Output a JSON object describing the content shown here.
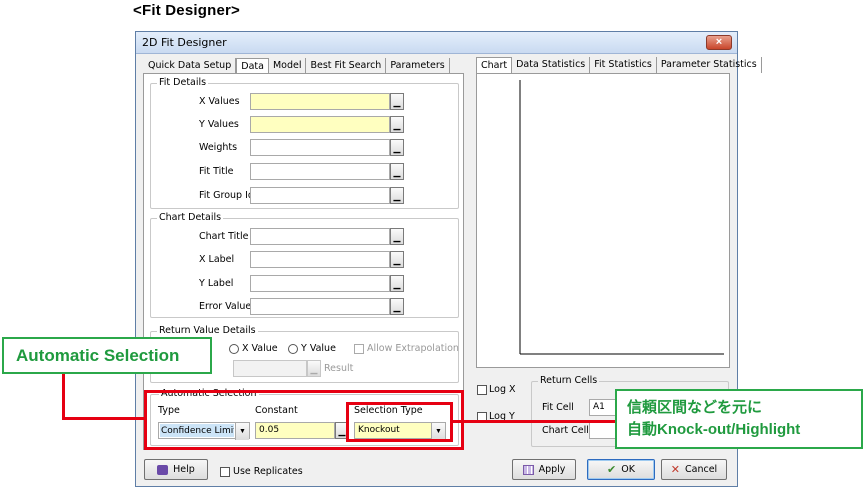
{
  "heading": "<Fit Designer>",
  "window": {
    "title": "2D Fit Designer",
    "close_icon": "×"
  },
  "left_tabs": [
    "Quick Data Setup",
    "Data",
    "Model",
    "Best Fit Search",
    "Parameters"
  ],
  "left_tabs_active": "Data",
  "fit_details": {
    "legend": "Fit Details",
    "rows": [
      {
        "label": "X Values",
        "value": "",
        "highlight": "#ffffc0"
      },
      {
        "label": "Y Values",
        "value": "",
        "highlight": "#ffffc0"
      },
      {
        "label": "Weights",
        "value": ""
      },
      {
        "label": "Fit Title",
        "value": ""
      },
      {
        "label": "Fit Group Id",
        "value": ""
      }
    ]
  },
  "chart_details": {
    "legend": "Chart Details",
    "rows": [
      {
        "label": "Chart Title",
        "value": ""
      },
      {
        "label": "X Label",
        "value": ""
      },
      {
        "label": "Y Label",
        "value": ""
      },
      {
        "label": "Error Values",
        "value": ""
      }
    ]
  },
  "return_value_details": {
    "legend": "Return Value Details",
    "x_value": "X Value",
    "y_value": "Y Value",
    "allow_extrapolation": "Allow Extrapolation",
    "result_label": "Result"
  },
  "automatic_selection": {
    "legend": "Automatic Selection",
    "type_label": "Type",
    "type_value": "Confidence Limits",
    "constant_label": "Constant",
    "constant_value": "0.05",
    "selection_type_label": "Selection Type",
    "selection_type_value": "Knockout"
  },
  "right_tabs": [
    "Chart",
    "Data Statistics",
    "Fit Statistics",
    "Parameter Statistics"
  ],
  "right_tabs_active": "Chart",
  "log_x": "Log X",
  "log_y": "Log Y",
  "return_cells": {
    "legend": "Return Cells",
    "fit_cell_label": "Fit Cell",
    "fit_cell_value": "A1",
    "chart_cell_label": "Chart Cell",
    "chart_cell_value": ""
  },
  "bottom": {
    "help": "Help",
    "use_replicates": "Use Replicates",
    "apply": "Apply",
    "ok": "OK",
    "cancel": "Cancel"
  },
  "callouts": {
    "left": "Automatic Selection",
    "right_line1": "信頼区間などを元に",
    "right_line2": "自動Knock-out/Highlight"
  },
  "colors": {
    "highlight_red": "#e60012",
    "callout_green": "#2ba84a",
    "selected_blue": "#cce4f7"
  },
  "icons": {
    "help": "help-book-icon",
    "apply": "apply-table-icon",
    "ok": "checkmark-icon",
    "cancel": "x-icon",
    "combo": "chevron-down-icon",
    "browse": "range-picker-icon"
  }
}
